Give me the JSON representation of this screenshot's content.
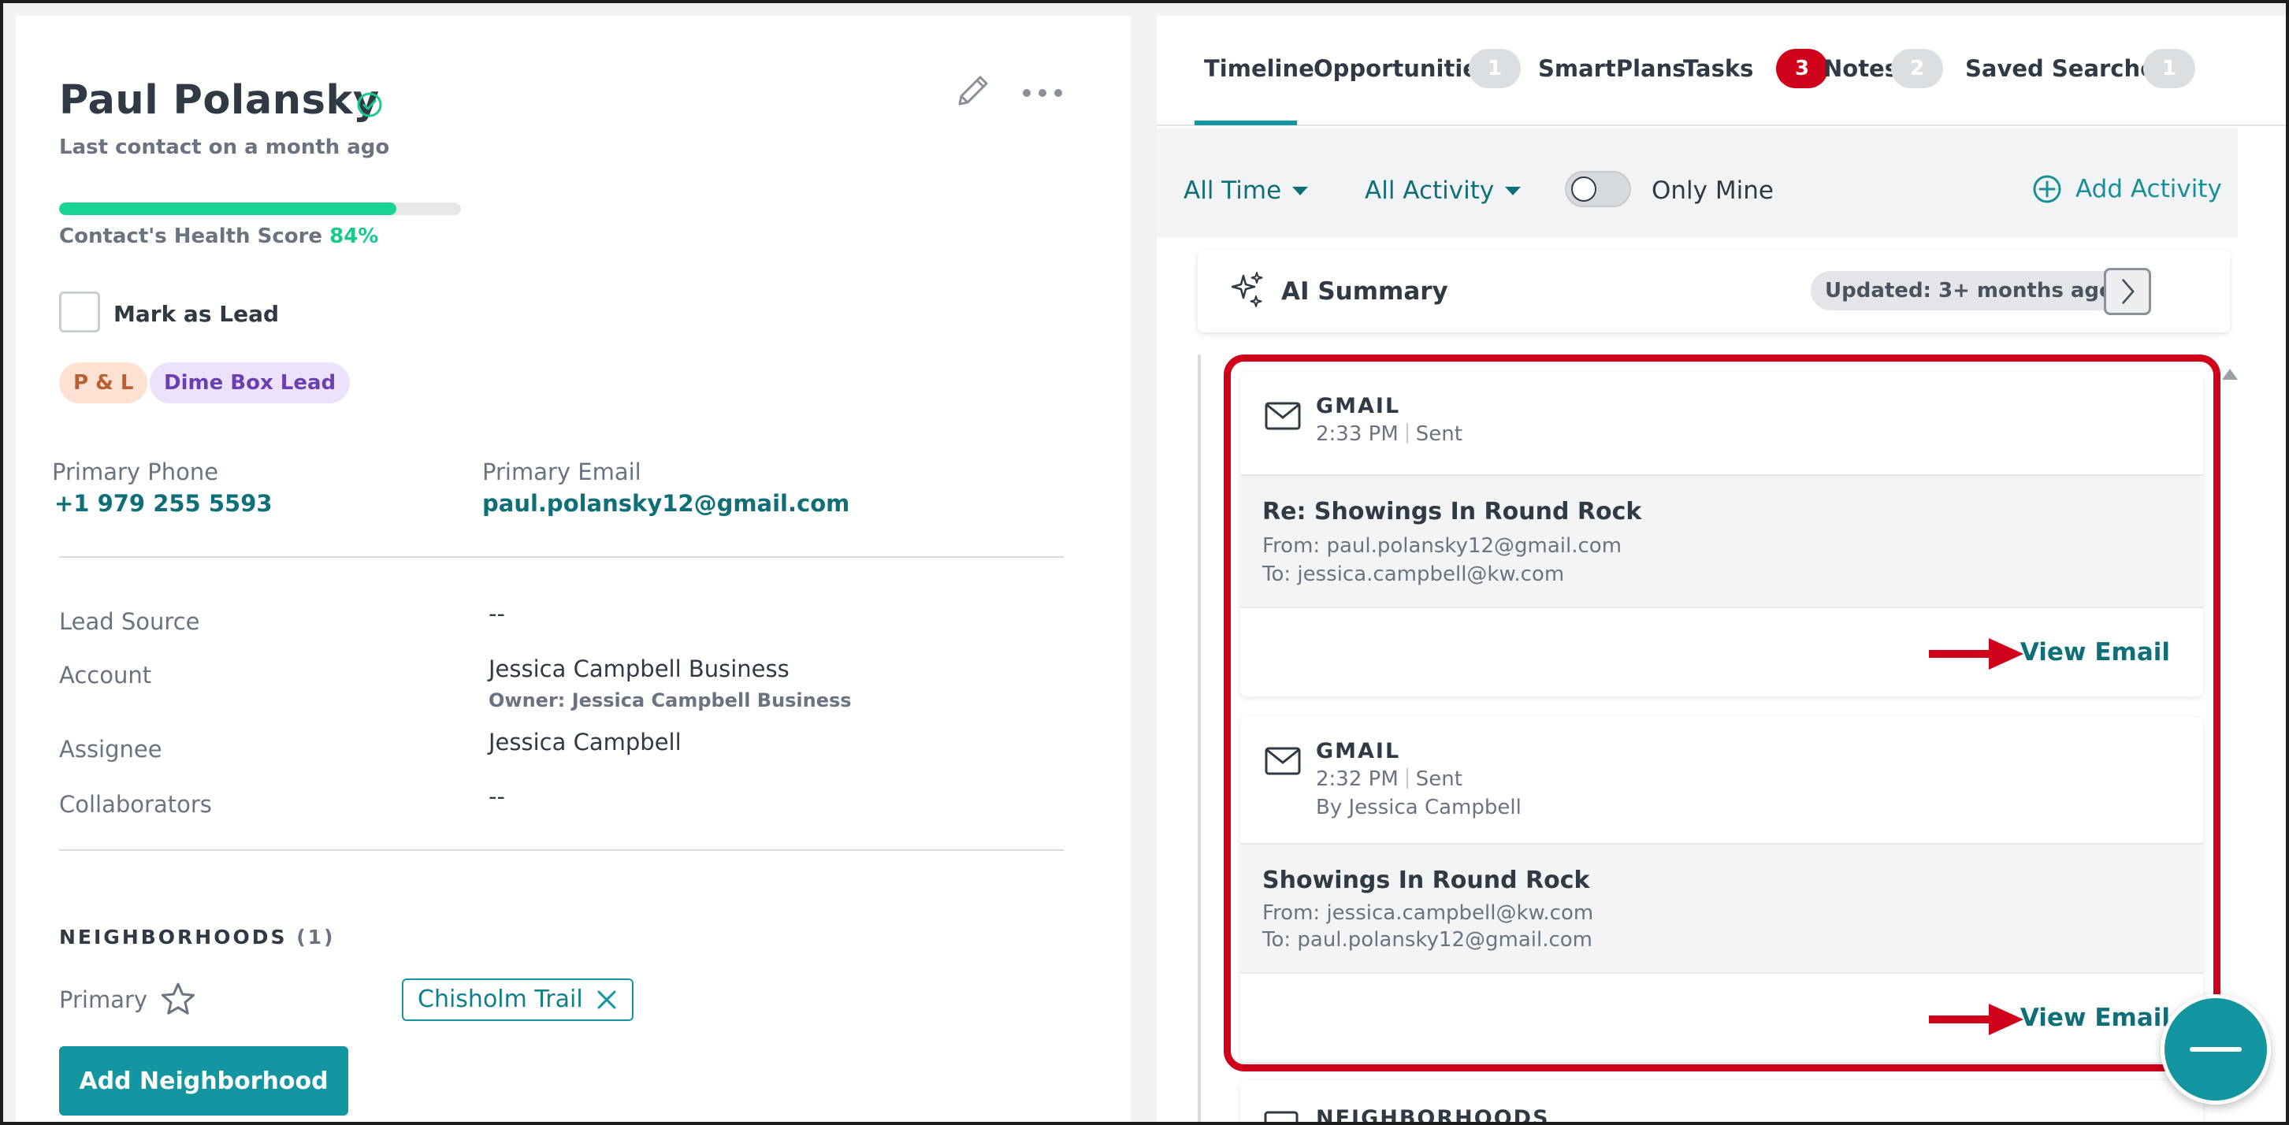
{
  "contact": {
    "name": "Paul Polansky",
    "last_contact": "Last contact on a month ago",
    "health_label": "Contact's Health Score",
    "health_pct_text": "84%",
    "health_value": 0.84,
    "mark_as_lead": "Mark as Lead",
    "tags": [
      "P & L",
      "Dime Box Lead"
    ]
  },
  "contact_info": {
    "phone_label": "Primary Phone",
    "phone": "+1 979 255 5593",
    "email_label": "Primary Email",
    "email": "paul.polansky12@gmail.com"
  },
  "details": {
    "lead_source_label": "Lead Source",
    "lead_source": "--",
    "account_label": "Account",
    "account": "Jessica Campbell Business",
    "account_owner": "Owner: Jessica Campbell Business",
    "assignee_label": "Assignee",
    "assignee": "Jessica Campbell",
    "collaborators_label": "Collaborators",
    "collaborators": "--"
  },
  "neighborhoods": {
    "title": "NEIGHBORHOODS",
    "count": "(1)",
    "primary_label": "Primary",
    "chip": "Chisholm Trail",
    "add_button": "Add Neighborhood"
  },
  "tabs": [
    {
      "label": "Timeline"
    },
    {
      "label": "Opportunities",
      "badge": "1"
    },
    {
      "label": "SmartPlans"
    },
    {
      "label": "Tasks",
      "badge": "3"
    },
    {
      "label": "Notes",
      "badge": "2"
    },
    {
      "label": "Saved Searches",
      "badge": "1"
    }
  ],
  "filters": {
    "time": "All Time",
    "activity": "All Activity",
    "only_mine": "Only Mine",
    "add_activity": "Add Activity"
  },
  "ai_summary": {
    "title": "AI Summary",
    "updated": "Updated: 3+ months ago"
  },
  "emails": [
    {
      "source": "GMAIL",
      "time": "2:33 PM",
      "status": "Sent",
      "subject": "Re: Showings In Round Rock",
      "from": "From: paul.polansky12@gmail.com",
      "to": "To: jessica.campbell@kw.com",
      "action": "View Email"
    },
    {
      "source": "GMAIL",
      "time": "2:32 PM",
      "status": "Sent",
      "by": "By Jessica Campbell",
      "subject": "Showings In Round Rock",
      "from": "From: jessica.campbell@kw.com",
      "to": "To: paul.polansky12@gmail.com",
      "action": "View Email"
    }
  ],
  "next_card": {
    "title": "NEIGHBORHOODS"
  },
  "colors": {
    "accent": "#1496a0",
    "link": "#0f6f78",
    "health": "#18d496",
    "alert": "#d0021b"
  }
}
